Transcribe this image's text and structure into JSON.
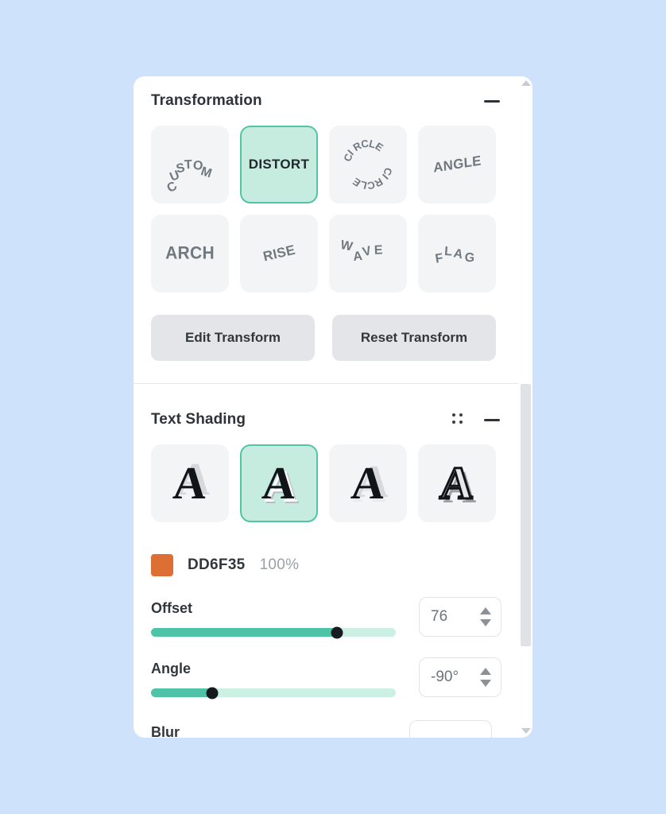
{
  "background_color": "#cfe2fb",
  "panel": {
    "accent_selected_bg": "#c6ecdf",
    "accent_selected_border": "#55c4a5",
    "slider_fill": "#4ec3a7",
    "slider_track": "#cdf0e4"
  },
  "transformation": {
    "title": "Transformation",
    "minimize_icon": "minimize-icon",
    "presets_row1": [
      {
        "label": "CUSTOM",
        "style": "curve-arc",
        "selected": false
      },
      {
        "label": "DISTORT",
        "style": "flat",
        "selected": true
      },
      {
        "label": "CIRCLE CIRCLE",
        "style": "ring",
        "selected": false
      },
      {
        "label": "ANGLE",
        "style": "slant",
        "selected": false
      }
    ],
    "presets_row2": [
      {
        "label": "ARCH",
        "style": "arch",
        "selected": false
      },
      {
        "label": "RISE",
        "style": "rise",
        "selected": false
      },
      {
        "label": "WAVE",
        "style": "wave",
        "selected": false
      },
      {
        "label": "FLAG",
        "style": "flag",
        "selected": false
      }
    ],
    "edit_button": "Edit Transform",
    "reset_button": "Reset Transform"
  },
  "text_shading": {
    "title": "Text Shading",
    "drag_handle_icon": "drag-handle-icon",
    "minimize_icon": "minimize-icon",
    "shading_options": [
      {
        "glyph": "A",
        "selected": false
      },
      {
        "glyph": "A",
        "selected": true
      },
      {
        "glyph": "A",
        "selected": false
      },
      {
        "glyph": "A",
        "selected": false
      }
    ],
    "color": {
      "swatch_hex": "#dd6f35",
      "hex_label": "DD6F35",
      "opacity_label": "100%"
    },
    "offset": {
      "label": "Offset",
      "value": "76",
      "percent": 76
    },
    "angle": {
      "label": "Angle",
      "value": "-90°",
      "percent": 25
    },
    "blur": {
      "label": "Blur"
    }
  },
  "scrollbar": {
    "up_icon": "scroll-up-arrow-icon",
    "down_icon": "scroll-down-arrow-icon"
  }
}
